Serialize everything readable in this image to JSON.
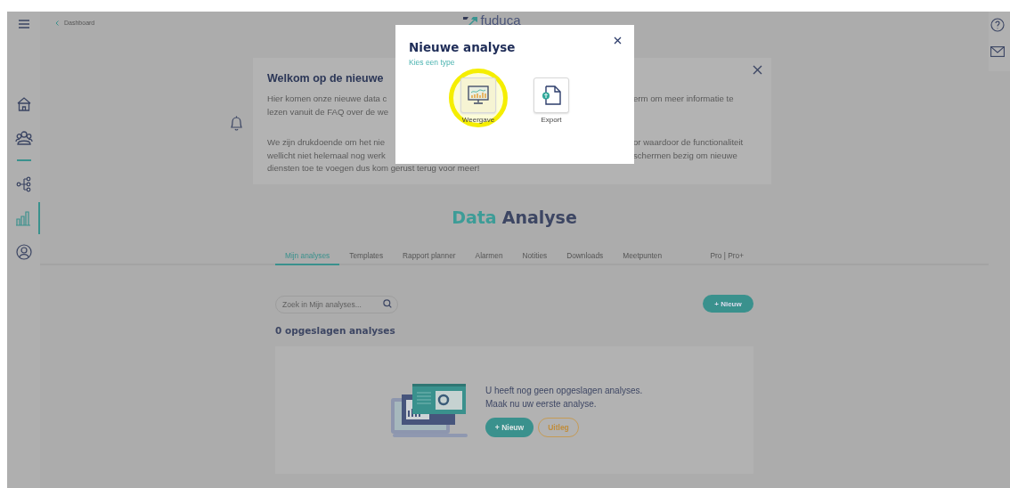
{
  "sidebar": {
    "items": [
      {
        "kind": "home",
        "selected": false
      },
      {
        "kind": "people",
        "selected": false
      },
      {
        "kind": "tree",
        "selected": false
      },
      {
        "kind": "chart",
        "selected": true
      },
      {
        "kind": "user",
        "selected": false
      }
    ]
  },
  "breadcrumb": {
    "label": "Dashboard"
  },
  "logo": {
    "text": "fuduca"
  },
  "welcome_card": {
    "title": "Welkom op de nieuwe",
    "paragraphs": [
      [
        {
          "kind": "split",
          "left": "Hier komen onze nieuwe data c",
          "right": "erm om meer informatie te"
        },
        {
          "kind": "split",
          "left": "lezen vanuit de FAQ over de we"
        }
      ],
      [
        {
          "kind": "split",
          "left": "We zijn drukdoende om het nie",
          "right": "or waardoor de functionaliteit"
        },
        {
          "kind": "split",
          "left": "wellicht niet helemaal nog werk",
          "right": "schermen bezig om nieuwe"
        },
        {
          "kind": "full",
          "text": "diensten toe te voegen dus kom gerust terug voor meer!"
        }
      ]
    ]
  },
  "page_title": {
    "first": "Data",
    "second": "Analyse"
  },
  "tabs": [
    {
      "label": "Mijn analyses",
      "selected": true
    },
    {
      "label": "Templates",
      "selected": false
    },
    {
      "label": "Rapport planner",
      "selected": false
    },
    {
      "label": "Alarmen",
      "selected": false
    },
    {
      "label": "Notities",
      "selected": false
    },
    {
      "label": "Downloads",
      "selected": false
    },
    {
      "label": "Meetpunten",
      "selected": false
    },
    {
      "label": "Pro | Pro+",
      "selected": false
    }
  ],
  "search": {
    "placeholder": "Zoek in Mijn analyses..."
  },
  "new_button": {
    "label": "+ Nieuw"
  },
  "count_heading": "0 opgeslagen analyses",
  "empty_state": {
    "lines": [
      "U heeft nog geen opgeslagen analyses.",
      "Maak nu uw eerste analyse."
    ],
    "buttons": [
      {
        "label": "+ Nieuw",
        "kind": "primary"
      },
      {
        "label": "Uitleg",
        "kind": "outline"
      }
    ]
  },
  "modal": {
    "title": "Nieuwe analyse",
    "subtitle": "Kies een type",
    "types": [
      {
        "label": "Weergave",
        "kind": "display",
        "selected": true
      },
      {
        "label": "Export",
        "kind": "export",
        "selected": false
      }
    ]
  }
}
